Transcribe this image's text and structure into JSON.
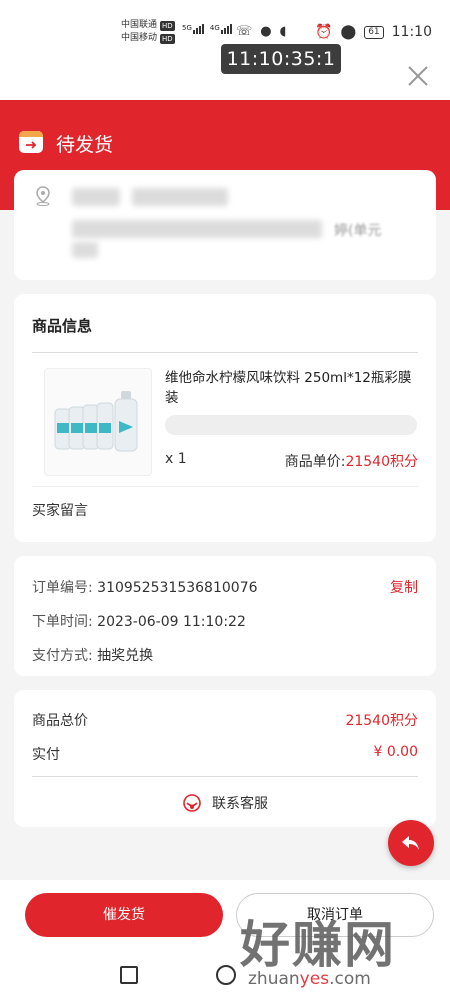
{
  "status_bar": {
    "carrier1": "中国联通",
    "carrier2": "中国移动",
    "hd": "HD",
    "net1": "5G",
    "net2": "4G",
    "battery": "61",
    "time": "11:10",
    "overlay_time": "11:10:35:1"
  },
  "header": {
    "title": "待发货"
  },
  "address": {
    "blurred_suffix": "婷(单元"
  },
  "goods": {
    "section_title": "商品信息",
    "product_title": "维他命水柠檬风味饮料 250ml*12瓶彩膜装",
    "quantity": "x 1",
    "unit_price_label": "商品单价:",
    "unit_price_value": "21540积分",
    "buyer_message_label": "买家留言"
  },
  "order": {
    "order_no_label": "订单编号:",
    "order_no": "310952531536810076",
    "copy_label": "复制",
    "order_time_label": "下单时间:",
    "order_time": "2023-06-09 11:10:22",
    "payment_label": "支付方式:",
    "payment_value": "抽奖兑换"
  },
  "payment": {
    "total_label": "商品总价",
    "total_value": "21540积分",
    "paid_label": "实付",
    "paid_value": "¥ 0.00",
    "service_label": "联系客服"
  },
  "actions": {
    "urge_label": "催发货",
    "cancel_label": "取消订单"
  },
  "watermark": {
    "text": "好赚网",
    "url_prefix": "zhuan",
    "url_highlight": "yes",
    "url_suffix": ".com"
  },
  "colors": {
    "brand_red": "#e0262c",
    "accent_orange": "#f3a64a"
  }
}
